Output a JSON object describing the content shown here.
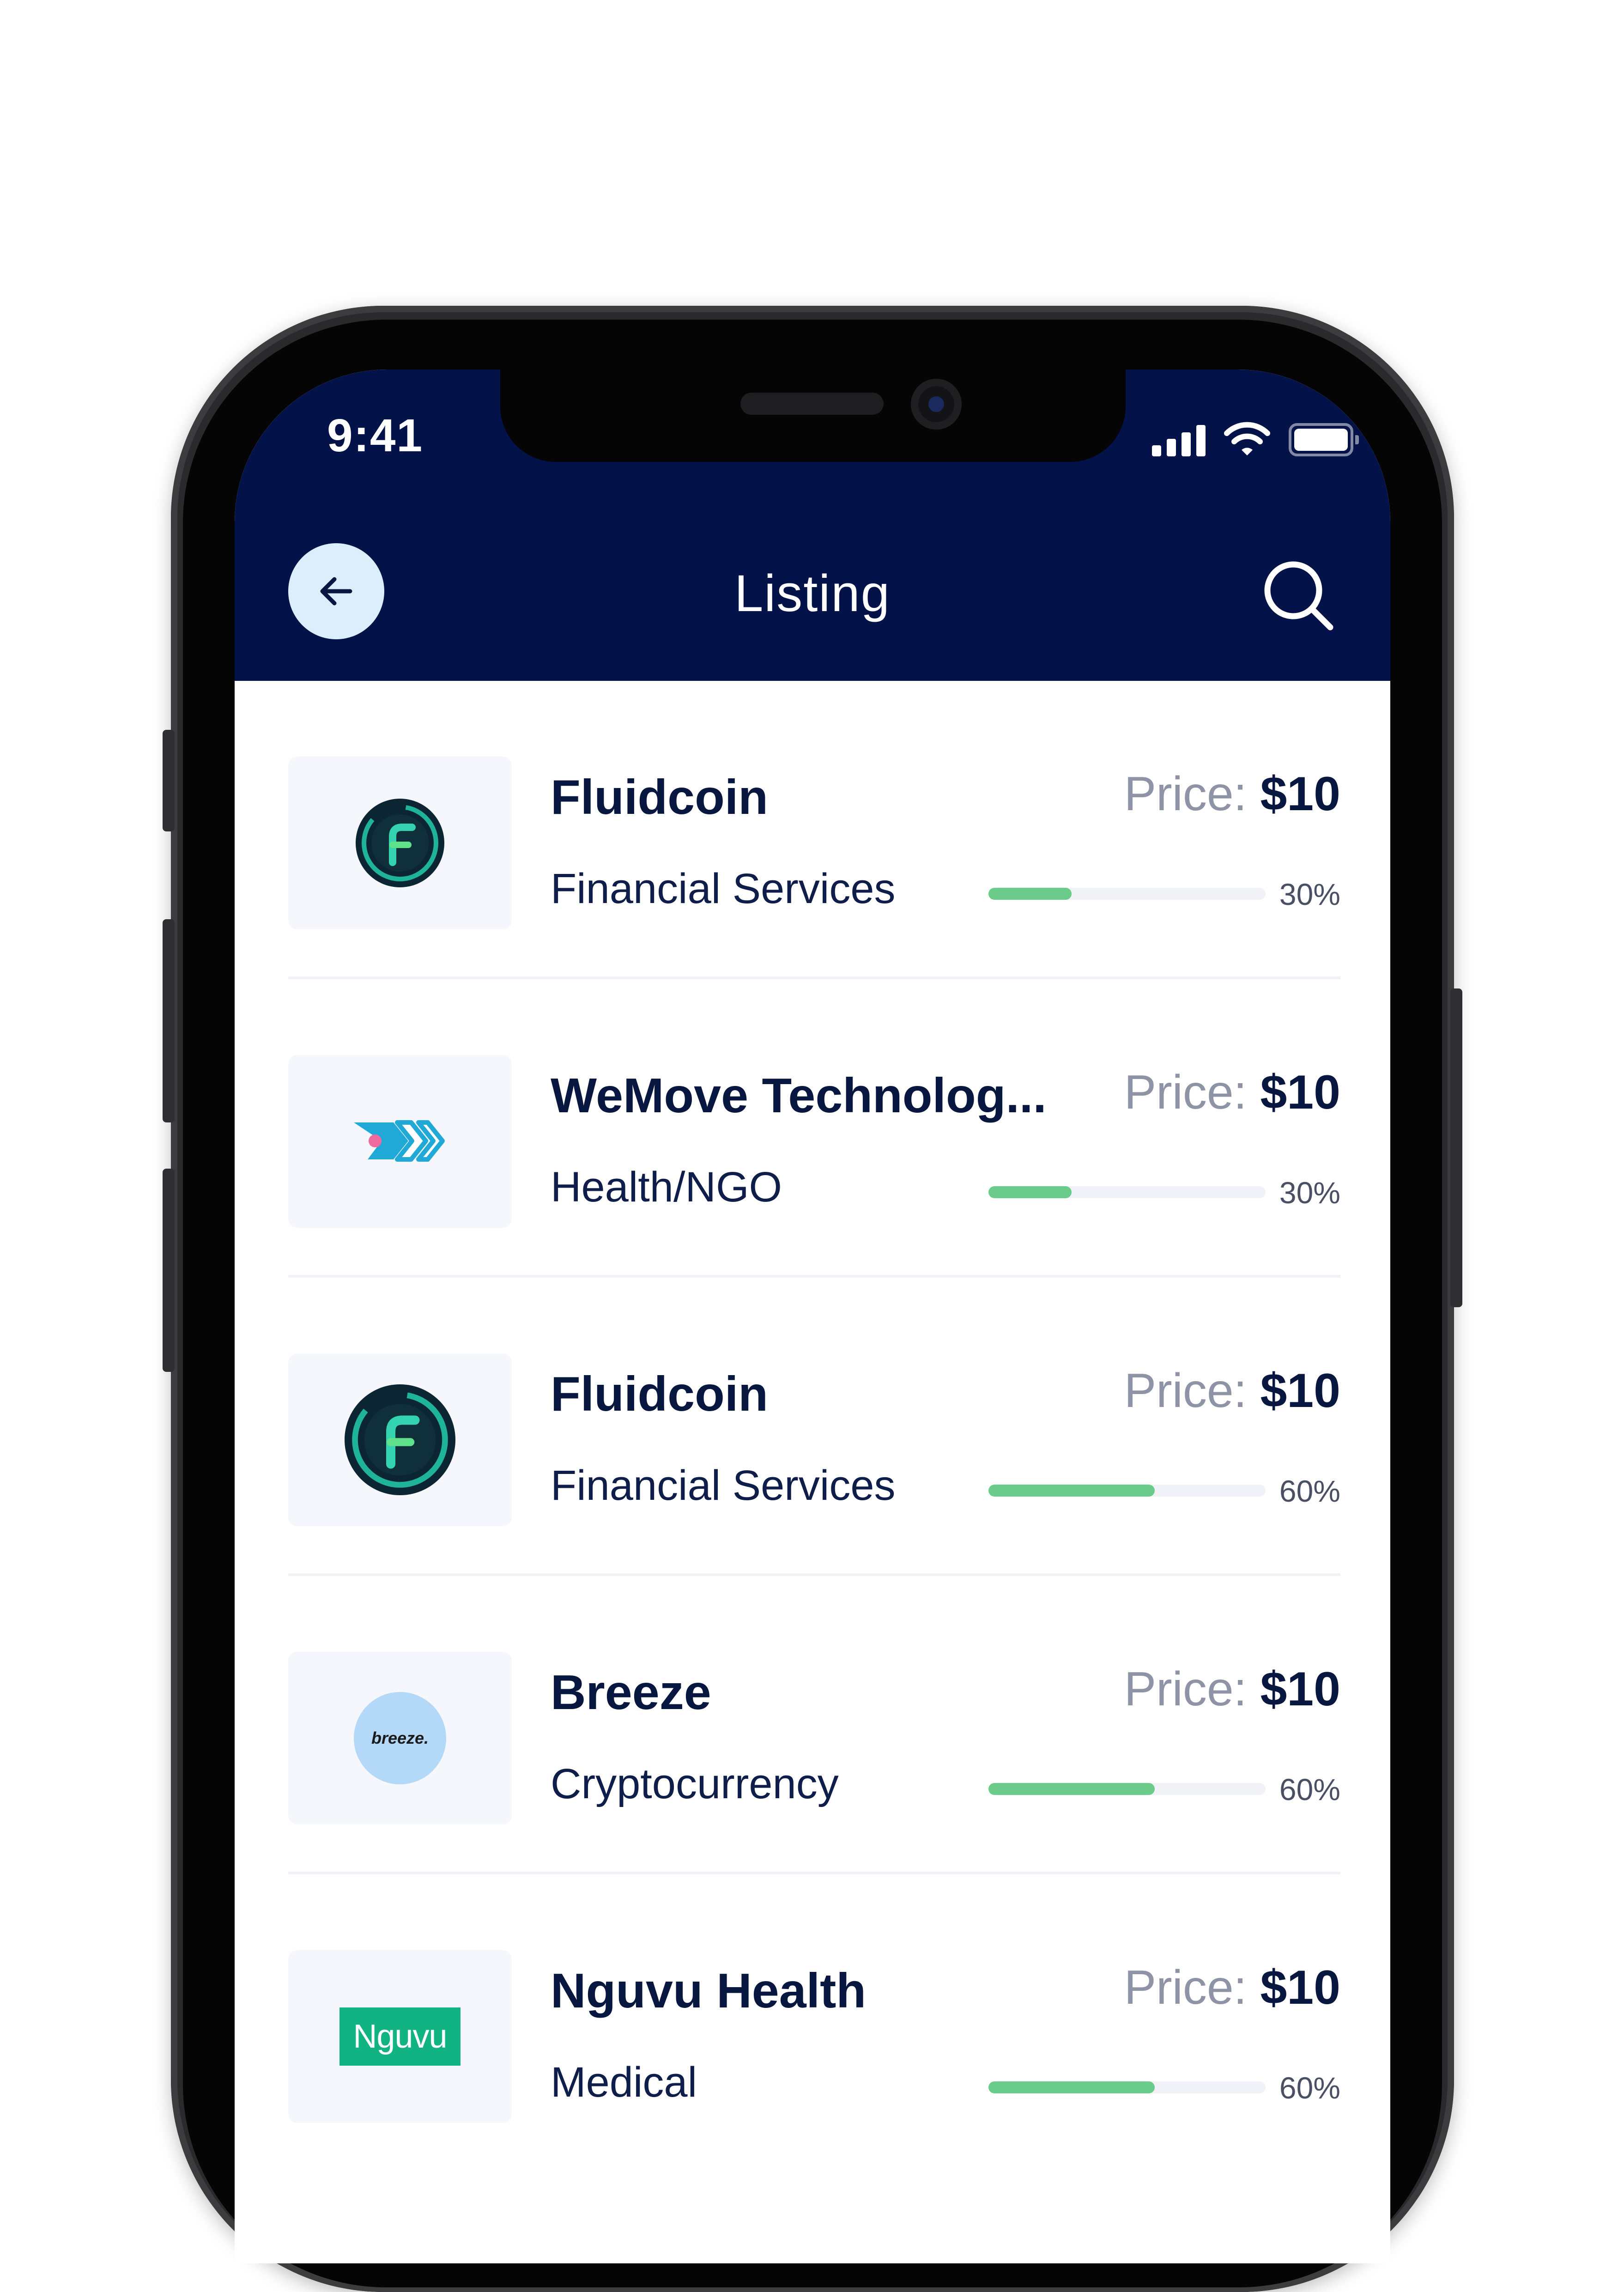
{
  "status_bar": {
    "time": "9:41"
  },
  "header": {
    "title": "Listing"
  },
  "icons": {
    "back": "arrow-left-icon",
    "search": "search-icon",
    "signal": "cellular-signal-icon",
    "wifi": "wifi-icon",
    "battery": "battery-icon"
  },
  "colors": {
    "header_bg": "#03134a",
    "progress": "#6bcb8a",
    "back_button_bg": "#dceefb"
  },
  "listings": [
    {
      "name": "Fluidcoin",
      "category": "Financial Services",
      "price_label": "Price:",
      "price_value": "$10",
      "progress": 0.3,
      "percent_text": "30%",
      "logo": "fluidcoin-logo"
    },
    {
      "name": "WeMove Technolog...",
      "category": "Health/NGO",
      "price_label": "Price:",
      "price_value": "$10",
      "progress": 0.3,
      "percent_text": "30%",
      "logo": "wemove-logo"
    },
    {
      "name": "Fluidcoin",
      "category": "Financial Services",
      "price_label": "Price:",
      "price_value": "$10",
      "progress": 0.6,
      "percent_text": "60%",
      "logo": "fluidcoin-logo"
    },
    {
      "name": "Breeze",
      "category": "Cryptocurrency",
      "price_label": "Price:",
      "price_value": "$10",
      "progress": 0.6,
      "percent_text": "60%",
      "logo": "breeze-logo",
      "logo_text": "breeze."
    },
    {
      "name": "Nguvu Health",
      "category": "Medical",
      "price_label": "Price:",
      "price_value": "$10",
      "progress": 0.6,
      "percent_text": "60%",
      "logo": "nguvu-logo",
      "logo_text": "Nguvu"
    }
  ]
}
